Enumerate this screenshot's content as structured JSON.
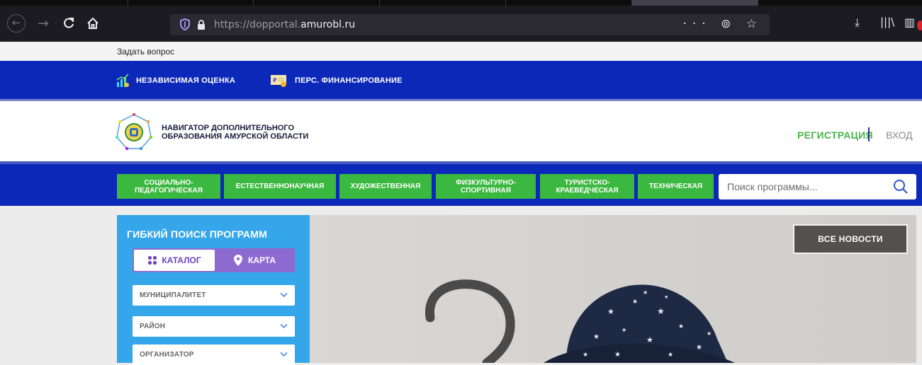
{
  "browser": {
    "url_prefix": "https://dopportal.",
    "url_domain": "amurobl.ru",
    "page_actions": "··· ⊚ ☆"
  },
  "site": {
    "ask_link": "Задать вопрос",
    "top_links": [
      {
        "label": "НЕЗАВИСИМАЯ ОЦЕНКА",
        "icon": "chart-icon"
      },
      {
        "label": "ПЕРС. ФИНАНСИРОВАНИЕ",
        "icon": "certificate-icon"
      }
    ],
    "logo_line1": "НАВИГАТОР ДОПОЛНИТЕЛЬНОГО",
    "logo_line2": "ОБРАЗОВАНИЯ АМУРСКОЙ ОБЛАСТИ",
    "register": "РЕГИСТРАЦИЯ",
    "login": "ВХОД",
    "nav": [
      {
        "line1": "СОЦИАЛЬНО-",
        "line2": "ПЕДАГОГИЧЕСКАЯ"
      },
      {
        "line1": "ЕСТЕСТВЕННОНАУЧНАЯ",
        "line2": ""
      },
      {
        "line1": "ХУДОЖЕСТВЕННАЯ",
        "line2": ""
      },
      {
        "line1": "ФИЗКУЛЬТУРНО-",
        "line2": "СПОРТИВНАЯ"
      },
      {
        "line1": "ТУРИСТСКО-",
        "line2": "КРАЕВЕДЧЕСКАЯ"
      },
      {
        "line1": "ТЕХНИЧЕСКАЯ",
        "line2": ""
      }
    ],
    "search_placeholder": "Поиск программы...",
    "filter": {
      "title": "ГИБКИЙ ПОИСК ПРОГРАММ",
      "catalog": "КАТАЛОГ",
      "map": "КАРТА",
      "selects": [
        "МУНИЦИПАЛИТЕТ",
        "РАЙОН",
        "ОРГАНИЗАТОР"
      ]
    },
    "all_news": "ВСЕ НОВОСТИ"
  },
  "colors": {
    "brand_blue": "#0c28b8",
    "green": "#3bb83f",
    "filter_blue": "#35a6ea",
    "purple": "#8d6ad0"
  }
}
